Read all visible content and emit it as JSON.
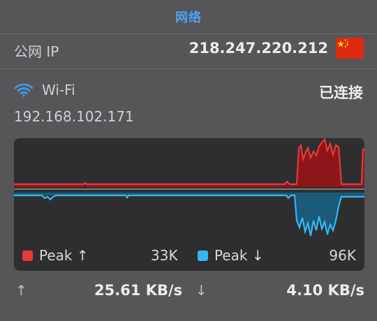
{
  "header": {
    "title": "网络"
  },
  "public_ip": {
    "label": "公网 IP",
    "value": "218.247.220.212",
    "flag_icon": "china-flag-icon"
  },
  "wifi": {
    "label": "Wi-Fi",
    "status": "已连接",
    "local_ip": "192.168.102.171",
    "icon": "wifi-icon"
  },
  "graph": {
    "upload_color": "#e5393b",
    "download_color": "#35b6f2",
    "legend_up_label": "Peak ↑",
    "legend_up_value": "33K",
    "legend_down_label": "Peak ↓",
    "legend_down_value": "96K"
  },
  "speeds": {
    "up_arrow": "↑",
    "up_value": "25.61 KB/s",
    "down_arrow": "↓",
    "down_value": "4.10 KB/s"
  }
}
